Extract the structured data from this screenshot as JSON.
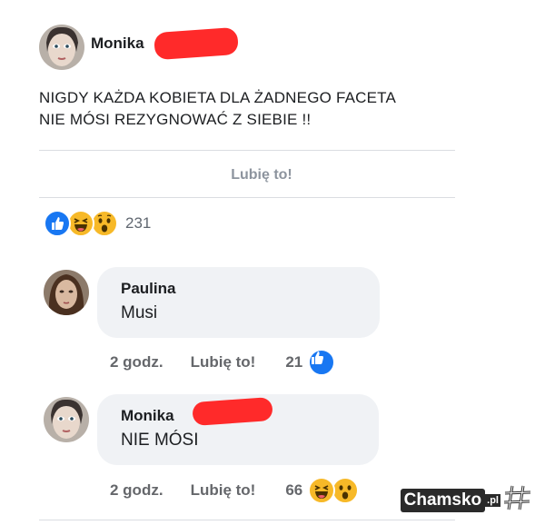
{
  "post": {
    "author": "Monika",
    "text_line1": "NIGDY KAŻDA KOBIETA DLA ŻADNEGO FACETA",
    "text_line2": "NIE MÓSI  REZYGNOWAĆ Z SIEBIE !!",
    "like_label": "Lubię to!",
    "reaction_count": "231",
    "reactions": [
      "like-icon",
      "haha-icon",
      "wow-icon"
    ]
  },
  "comments": [
    {
      "author": "Paulina",
      "text": "Musi",
      "time": "2 godz.",
      "like_label": "Lubię to!",
      "reaction_count": "21",
      "reactions": [
        "like-icon"
      ]
    },
    {
      "author": "Monika",
      "text": "NIE MÓSI",
      "time": "2 godz.",
      "like_label": "Lubię to!",
      "reaction_count": "66",
      "reactions": [
        "haha-icon",
        "wow-icon"
      ]
    }
  ],
  "watermark": {
    "text": "Chamsko",
    "suffix": ".pl"
  },
  "colors": {
    "like_blue": "#1877f2",
    "reaction_yellow": "#f7b928",
    "redaction": "#ff2a2a",
    "bubble": "#f0f2f5"
  }
}
